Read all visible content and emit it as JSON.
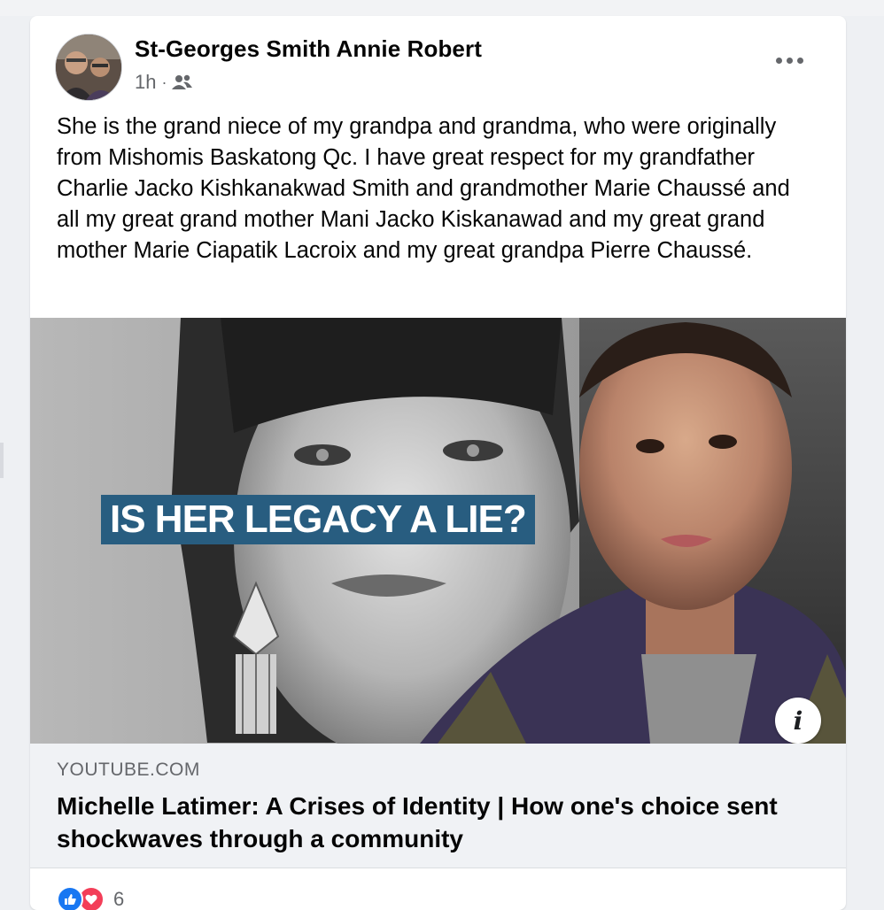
{
  "post": {
    "author": "St-Georges Smith Annie Robert",
    "time": "1h",
    "separator": "·",
    "audience_icon": "friends-icon",
    "more_icon": "more-options-icon",
    "text": "She is the grand niece of my grandpa and grandma, who were originally from Mishomis Baskatong Qc. I have great respect for my grandfather  Charlie Jacko Kishkanakwad Smith and grandmother Marie Chaussé and all my great grand mother Mani Jacko Kiskanawad and my great grand mother Marie Ciapatik Lacroix and my great grandpa Pierre Chaussé."
  },
  "link": {
    "thumbnail_title": "IS HER LEGACY A LIE?",
    "info_icon": "i",
    "domain": "YOUTUBE.COM",
    "title": "Michelle Latimer: A Crises of Identity | How one's choice sent shockwaves through a community"
  },
  "reactions": {
    "types": [
      "like",
      "love"
    ],
    "count": "6"
  },
  "colors": {
    "text": "#050505",
    "secondary": "#65676b",
    "like": "#1877f2",
    "love": "#f33e58",
    "banner": "#285d80",
    "link_meta_bg": "#f0f2f5"
  }
}
